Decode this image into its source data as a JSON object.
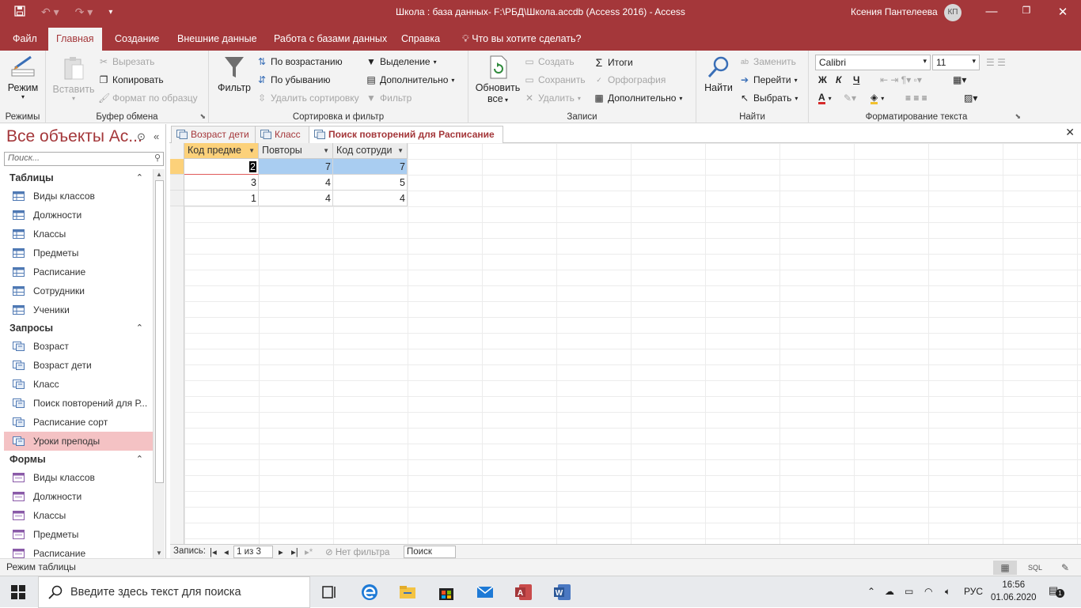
{
  "window": {
    "title": "Школа : база данных- F:\\РБД\\Школа.accdb (Access 2016)  -  Access",
    "user_name": "Ксения Пантелеева",
    "user_initials": "КП"
  },
  "ribbon_tabs": [
    "Файл",
    "Главная",
    "Создание",
    "Внешние данные",
    "Работа с базами данных",
    "Справка"
  ],
  "tell_me": "Что вы хотите сделать?",
  "ribbon": {
    "modes": {
      "view": "Режим",
      "group": "Режимы"
    },
    "clipboard": {
      "paste": "Вставить",
      "cut": "Вырезать",
      "copy": "Копировать",
      "format_painter": "Формат по образцу",
      "group": "Буфер обмена"
    },
    "sort_filter": {
      "filter": "Фильтр",
      "ascending": "По возрастанию",
      "descending": "По убыванию",
      "remove_sort": "Удалить сортировку",
      "selection": "Выделение",
      "advanced": "Дополнительно",
      "toggle_filter": "Фильтр",
      "group": "Сортировка и фильтр"
    },
    "records": {
      "refresh_1": "Обновить",
      "refresh_2": "все",
      "new": "Создать",
      "save": "Сохранить",
      "delete": "Удалить",
      "totals": "Итоги",
      "spelling": "Орфография",
      "more": "Дополнительно",
      "group": "Записи"
    },
    "find": {
      "find": "Найти",
      "replace": "Заменить",
      "goto": "Перейти",
      "select": "Выбрать",
      "group": "Найти"
    },
    "text_format": {
      "font_name": "Calibri",
      "font_size": "11",
      "bold": "Ж",
      "italic": "К",
      "underline": "Ч",
      "font_color_letter": "A",
      "group": "Форматирование текста"
    }
  },
  "nav_pane": {
    "title": "Все объекты Ac...",
    "search_placeholder": "Поиск...",
    "sections": [
      {
        "name": "Таблицы",
        "kind": "table",
        "items": [
          "Виды классов",
          "Должности",
          "Классы",
          "Предметы",
          "Расписание",
          "Сотрудники",
          "Ученики"
        ]
      },
      {
        "name": "Запросы",
        "kind": "query",
        "items": [
          "Возраст",
          "Возраст дети",
          "Класс",
          "Поиск повторений для Р...",
          "Расписание сорт",
          "Уроки преподы"
        ]
      },
      {
        "name": "Формы",
        "kind": "form",
        "items": [
          "Виды классов",
          "Должности",
          "Классы",
          "Предметы",
          "Расписание"
        ]
      }
    ],
    "selected_item": "Уроки преподы"
  },
  "doc_tabs": [
    "Возраст дети",
    "Класс",
    "Поиск повторений для Расписание"
  ],
  "active_doc_tab": "Поиск повторений для Расписание",
  "datasheet": {
    "columns": [
      "Код предме",
      "Повторы",
      "Код сотруди"
    ],
    "rows": [
      [
        "2",
        "7",
        "7"
      ],
      [
        "3",
        "4",
        "5"
      ],
      [
        "1",
        "4",
        "4"
      ]
    ]
  },
  "record_nav": {
    "label": "Запись:",
    "position": "1 из 3",
    "filter": "Нет фильтра",
    "search": "Поиск"
  },
  "status_bar": {
    "text": "Режим таблицы",
    "sql": "SQL"
  },
  "taskbar": {
    "search_placeholder": "Введите здесь текст для поиска",
    "lang": "РУС",
    "time": "16:56",
    "date": "01.06.2020",
    "notifications": "1"
  },
  "colors": {
    "accent": "#a4373a",
    "header_highlight": "#fcd17a",
    "cell_highlight": "#a9cdf1",
    "nav_selected": "#f4c2c4"
  }
}
